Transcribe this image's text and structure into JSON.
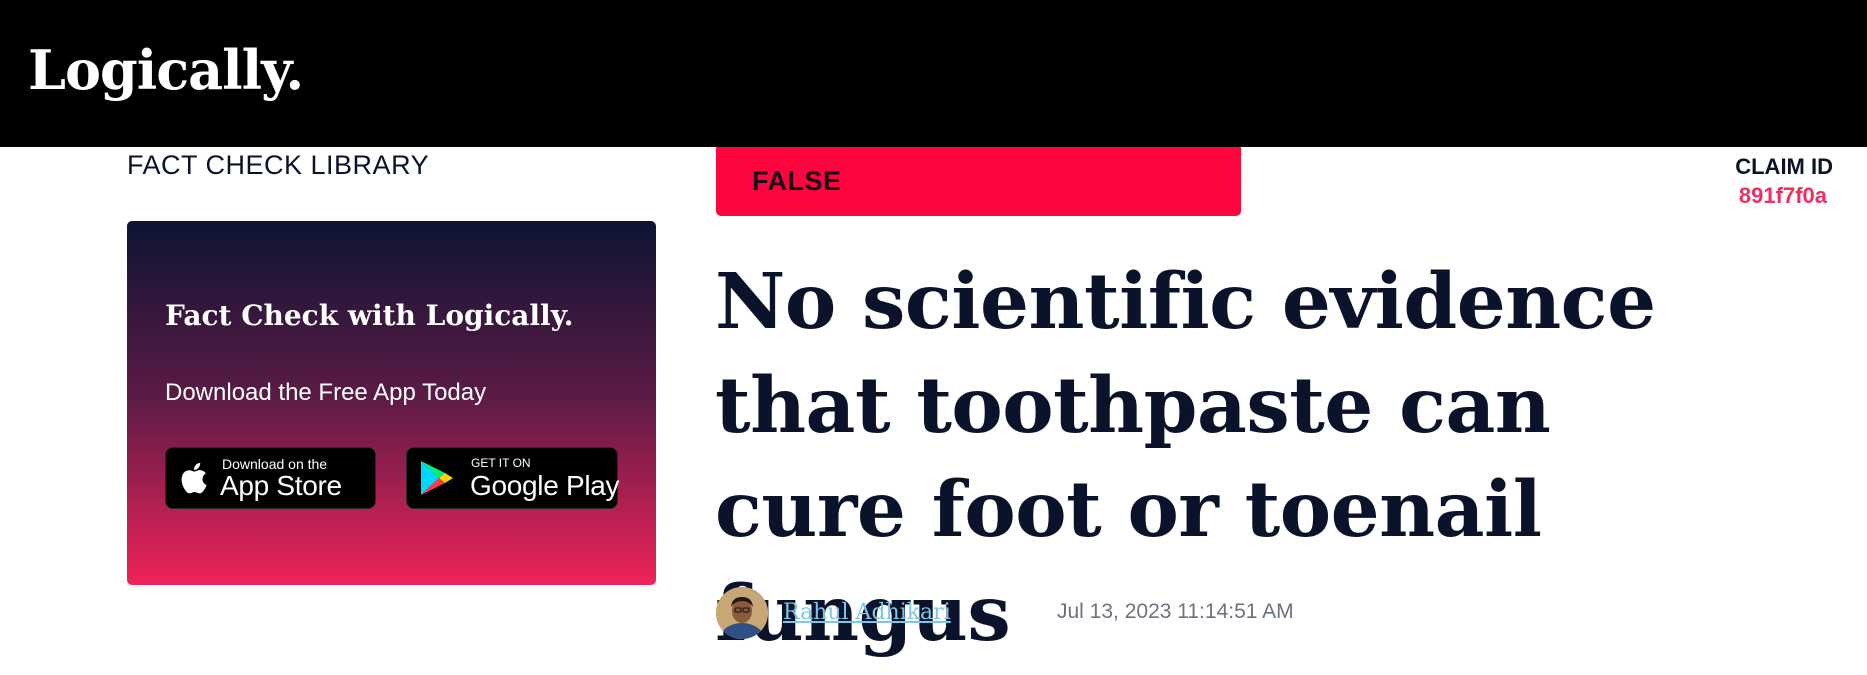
{
  "header": {
    "logo_text": "Logically."
  },
  "sidebar": {
    "library_label": "FACT CHECK LIBRARY",
    "promo": {
      "title": "Fact Check with Logically.",
      "subtitle": "Download the Free App Today",
      "app_store": {
        "small": "Download on the",
        "big": "App Store",
        "icon": "apple-icon"
      },
      "google_play": {
        "small": "GET IT ON",
        "big": "Google Play",
        "icon": "google-play-icon"
      }
    }
  },
  "article": {
    "verdict": "FALSE",
    "verdict_color": "#ff053f",
    "claim_id_label": "CLAIM ID",
    "claim_id": "891f7f0a",
    "headline": "No scientific evidence that toothpaste can cure foot or toenail fungus",
    "author": "Rahul Adhikari",
    "timestamp": "Jul 13, 2023 11:14:51 AM"
  },
  "colors": {
    "accent": "#ff053f",
    "navy": "#0b132b",
    "link": "#7dc6e8"
  }
}
